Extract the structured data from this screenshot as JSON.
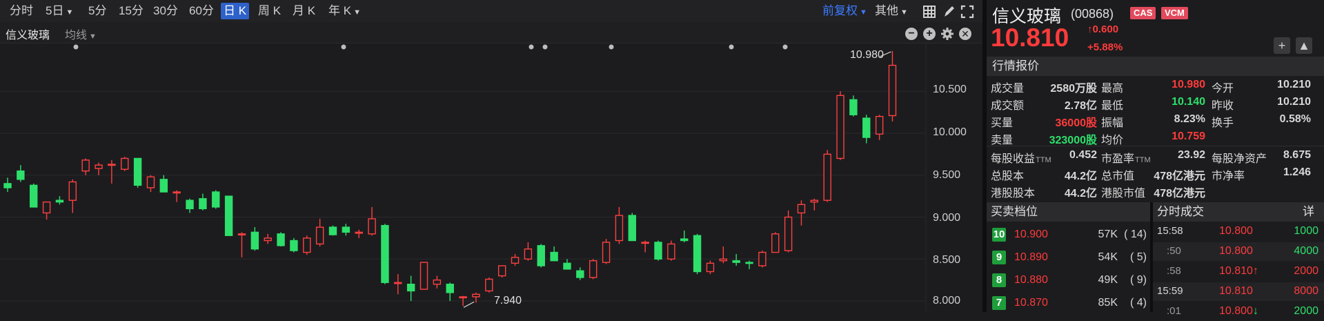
{
  "toolbar": {
    "tabs": [
      "分时",
      "5日",
      "5分",
      "15分",
      "30分",
      "60分",
      "日 K",
      "周 K",
      "月 K",
      "年 K"
    ],
    "active_tab": "日 K",
    "adjust": "前复权",
    "other": "其他"
  },
  "subbar": {
    "stock_label": "信义玻璃",
    "ma_label": "均线"
  },
  "chart_data": {
    "type": "candlestick",
    "y_ticks": [
      "10.500",
      "10.000",
      "9.500",
      "9.000",
      "8.500",
      "8.000"
    ],
    "ylim": [
      7.9,
      11.0
    ],
    "high_marker": "10.980",
    "low_marker": "7.940",
    "candles": [
      {
        "o": 9.4,
        "h": 9.47,
        "l": 9.3,
        "c": 9.35
      },
      {
        "o": 9.55,
        "h": 9.62,
        "l": 9.42,
        "c": 9.45
      },
      {
        "o": 9.38,
        "h": 9.4,
        "l": 9.15,
        "c": 9.12
      },
      {
        "o": 9.05,
        "h": 9.18,
        "l": 8.97,
        "c": 9.18
      },
      {
        "o": 9.2,
        "h": 9.25,
        "l": 9.15,
        "c": 9.18
      },
      {
        "o": 9.2,
        "h": 9.45,
        "l": 9.05,
        "c": 9.42
      },
      {
        "o": 9.55,
        "h": 9.7,
        "l": 9.5,
        "c": 9.68
      },
      {
        "o": 9.58,
        "h": 9.65,
        "l": 9.5,
        "c": 9.62
      },
      {
        "o": 9.62,
        "h": 9.68,
        "l": 9.4,
        "c": 9.63
      },
      {
        "o": 9.57,
        "h": 9.72,
        "l": 9.55,
        "c": 9.7
      },
      {
        "o": 9.7,
        "h": 9.7,
        "l": 9.35,
        "c": 9.38
      },
      {
        "o": 9.35,
        "h": 9.5,
        "l": 9.3,
        "c": 9.48
      },
      {
        "o": 9.45,
        "h": 9.5,
        "l": 9.3,
        "c": 9.3
      },
      {
        "o": 9.3,
        "h": 9.32,
        "l": 9.18,
        "c": 9.3
      },
      {
        "o": 9.2,
        "h": 9.22,
        "l": 9.05,
        "c": 9.1
      },
      {
        "o": 9.22,
        "h": 9.28,
        "l": 9.08,
        "c": 9.1
      },
      {
        "o": 9.3,
        "h": 9.32,
        "l": 9.1,
        "c": 9.12
      },
      {
        "o": 9.25,
        "h": 9.25,
        "l": 8.78,
        "c": 8.78
      },
      {
        "o": 8.8,
        "h": 8.82,
        "l": 8.52,
        "c": 8.8
      },
      {
        "o": 8.82,
        "h": 8.88,
        "l": 8.6,
        "c": 8.62
      },
      {
        "o": 8.72,
        "h": 8.8,
        "l": 8.68,
        "c": 8.75
      },
      {
        "o": 8.8,
        "h": 8.82,
        "l": 8.65,
        "c": 8.66
      },
      {
        "o": 8.72,
        "h": 8.75,
        "l": 8.58,
        "c": 8.6
      },
      {
        "o": 8.58,
        "h": 8.78,
        "l": 8.55,
        "c": 8.75
      },
      {
        "o": 8.68,
        "h": 8.98,
        "l": 8.65,
        "c": 8.88
      },
      {
        "o": 8.88,
        "h": 8.9,
        "l": 8.78,
        "c": 8.79
      },
      {
        "o": 8.88,
        "h": 8.92,
        "l": 8.78,
        "c": 8.82
      },
      {
        "o": 8.82,
        "h": 8.85,
        "l": 8.75,
        "c": 8.82
      },
      {
        "o": 8.8,
        "h": 9.12,
        "l": 8.78,
        "c": 8.98
      },
      {
        "o": 8.9,
        "h": 8.92,
        "l": 8.2,
        "c": 8.22
      },
      {
        "o": 8.22,
        "h": 8.32,
        "l": 8.08,
        "c": 8.22
      },
      {
        "o": 8.2,
        "h": 8.3,
        "l": 8.0,
        "c": 8.12
      },
      {
        "o": 8.14,
        "h": 8.46,
        "l": 8.14,
        "c": 8.46
      },
      {
        "o": 8.2,
        "h": 8.3,
        "l": 8.15,
        "c": 8.25
      },
      {
        "o": 8.2,
        "h": 8.22,
        "l": 8.0,
        "c": 8.1
      },
      {
        "o": 8.05,
        "h": 8.06,
        "l": 7.94,
        "c": 8.05
      },
      {
        "o": 8.05,
        "h": 8.1,
        "l": 7.98,
        "c": 8.08
      },
      {
        "o": 8.12,
        "h": 8.28,
        "l": 8.1,
        "c": 8.26
      },
      {
        "o": 8.3,
        "h": 8.42,
        "l": 8.28,
        "c": 8.42
      },
      {
        "o": 8.45,
        "h": 8.56,
        "l": 8.42,
        "c": 8.52
      },
      {
        "o": 8.5,
        "h": 8.7,
        "l": 8.48,
        "c": 8.62
      },
      {
        "o": 8.66,
        "h": 8.68,
        "l": 8.4,
        "c": 8.42
      },
      {
        "o": 8.58,
        "h": 8.65,
        "l": 8.48,
        "c": 8.48
      },
      {
        "o": 8.45,
        "h": 8.5,
        "l": 8.38,
        "c": 8.38
      },
      {
        "o": 8.36,
        "h": 8.4,
        "l": 8.25,
        "c": 8.28
      },
      {
        "o": 8.28,
        "h": 8.5,
        "l": 8.26,
        "c": 8.48
      },
      {
        "o": 8.46,
        "h": 8.74,
        "l": 8.44,
        "c": 8.7
      },
      {
        "o": 8.72,
        "h": 9.12,
        "l": 8.68,
        "c": 9.02
      },
      {
        "o": 9.02,
        "h": 9.05,
        "l": 8.72,
        "c": 8.72
      },
      {
        "o": 8.7,
        "h": 8.72,
        "l": 8.58,
        "c": 8.7
      },
      {
        "o": 8.7,
        "h": 8.72,
        "l": 8.48,
        "c": 8.5
      },
      {
        "o": 8.5,
        "h": 8.72,
        "l": 8.48,
        "c": 8.68
      },
      {
        "o": 8.74,
        "h": 8.84,
        "l": 8.7,
        "c": 8.72
      },
      {
        "o": 8.78,
        "h": 8.8,
        "l": 8.32,
        "c": 8.35
      },
      {
        "o": 8.35,
        "h": 8.48,
        "l": 8.32,
        "c": 8.45
      },
      {
        "o": 8.48,
        "h": 8.65,
        "l": 8.45,
        "c": 8.5
      },
      {
        "o": 8.48,
        "h": 8.56,
        "l": 8.42,
        "c": 8.46
      },
      {
        "o": 8.46,
        "h": 8.48,
        "l": 8.38,
        "c": 8.45
      },
      {
        "o": 8.42,
        "h": 8.6,
        "l": 8.4,
        "c": 8.58
      },
      {
        "o": 8.58,
        "h": 8.82,
        "l": 8.58,
        "c": 8.8
      },
      {
        "o": 8.6,
        "h": 9.08,
        "l": 8.58,
        "c": 9.0
      },
      {
        "o": 9.05,
        "h": 9.2,
        "l": 8.9,
        "c": 9.15
      },
      {
        "o": 9.18,
        "h": 9.22,
        "l": 9.08,
        "c": 9.2
      },
      {
        "o": 9.2,
        "h": 9.8,
        "l": 9.18,
        "c": 9.75
      },
      {
        "o": 9.7,
        "h": 10.5,
        "l": 9.68,
        "c": 10.45
      },
      {
        "o": 10.4,
        "h": 10.45,
        "l": 10.2,
        "c": 10.22
      },
      {
        "o": 10.18,
        "h": 10.22,
        "l": 9.88,
        "c": 9.95
      },
      {
        "o": 9.99,
        "h": 10.22,
        "l": 9.92,
        "c": 10.2
      },
      {
        "o": 10.21,
        "h": 10.98,
        "l": 10.14,
        "c": 10.81
      }
    ]
  },
  "quote": {
    "name": "信义玻璃",
    "code": "(00868)",
    "badges": [
      "CAS",
      "VCM"
    ],
    "price": "10.810",
    "change": "0.600",
    "change_pct": "+5.88%"
  },
  "market": {
    "title": "行情报价",
    "rows": [
      [
        {
          "l": "成交量",
          "v": "2580万股",
          "c": ""
        },
        {
          "l": "最高",
          "v": "10.980",
          "c": "red"
        },
        {
          "l": "今开",
          "v": "10.210",
          "c": ""
        }
      ],
      [
        {
          "l": "成交额",
          "v": "2.78亿",
          "c": ""
        },
        {
          "l": "最低",
          "v": "10.140",
          "c": "green"
        },
        {
          "l": "昨收",
          "v": "10.210",
          "c": ""
        }
      ],
      [
        {
          "l": "买量",
          "v": "36000股",
          "c": "red"
        },
        {
          "l": "振幅",
          "v": "8.23%",
          "c": ""
        },
        {
          "l": "换手",
          "v": "0.58%",
          "c": ""
        }
      ],
      [
        {
          "l": "卖量",
          "v": "323000股",
          "c": "green"
        },
        {
          "l": "均价",
          "v": "10.759",
          "c": "red"
        }
      ]
    ],
    "rows2": [
      [
        {
          "l": "每股收益",
          "sub": "TTM",
          "v": "0.452"
        },
        {
          "l": "市盈率",
          "sub": "TTM",
          "v": "23.92"
        },
        {
          "l": "每股净资产",
          "sub": "",
          "v": "8.675"
        }
      ],
      [
        {
          "l": "总股本",
          "sub": "",
          "v": "44.2亿"
        },
        {
          "l": "总市值",
          "sub": "",
          "v": "478亿港元"
        },
        {
          "l": "市净率",
          "sub": "",
          "v": "1.246"
        }
      ],
      [
        {
          "l": "港股股本",
          "sub": "",
          "v": "44.2亿"
        },
        {
          "l": "港股市值",
          "sub": "",
          "v": "478亿港元"
        }
      ]
    ]
  },
  "orderbook": {
    "title": "买卖档位",
    "rows": [
      {
        "lvl": "10",
        "price": "10.900",
        "vol": "57K",
        "cnt": "( 14)"
      },
      {
        "lvl": "9",
        "price": "10.890",
        "vol": "54K",
        "cnt": "( 5)"
      },
      {
        "lvl": "8",
        "price": "10.880",
        "vol": "49K",
        "cnt": "( 9)"
      },
      {
        "lvl": "7",
        "price": "10.870",
        "vol": "85K",
        "cnt": "( 4)"
      }
    ]
  },
  "ticks": {
    "title": "分时成交",
    "detail": "详",
    "rows": [
      {
        "t": "15:58",
        "p": "10.800",
        "arrow": "",
        "v": "1000",
        "vc": "green"
      },
      {
        "t": ":50",
        "p": "10.800",
        "arrow": "",
        "v": "4000",
        "vc": "green"
      },
      {
        "t": ":58",
        "p": "10.810",
        "arrow": "↑",
        "v": "2000",
        "vc": "red"
      },
      {
        "t": "15:59",
        "p": "10.810",
        "arrow": "",
        "v": "8000",
        "vc": "red"
      },
      {
        "t": ":01",
        "p": "10.800",
        "arrow": "↓",
        "v": "2000",
        "vc": "green"
      }
    ]
  }
}
